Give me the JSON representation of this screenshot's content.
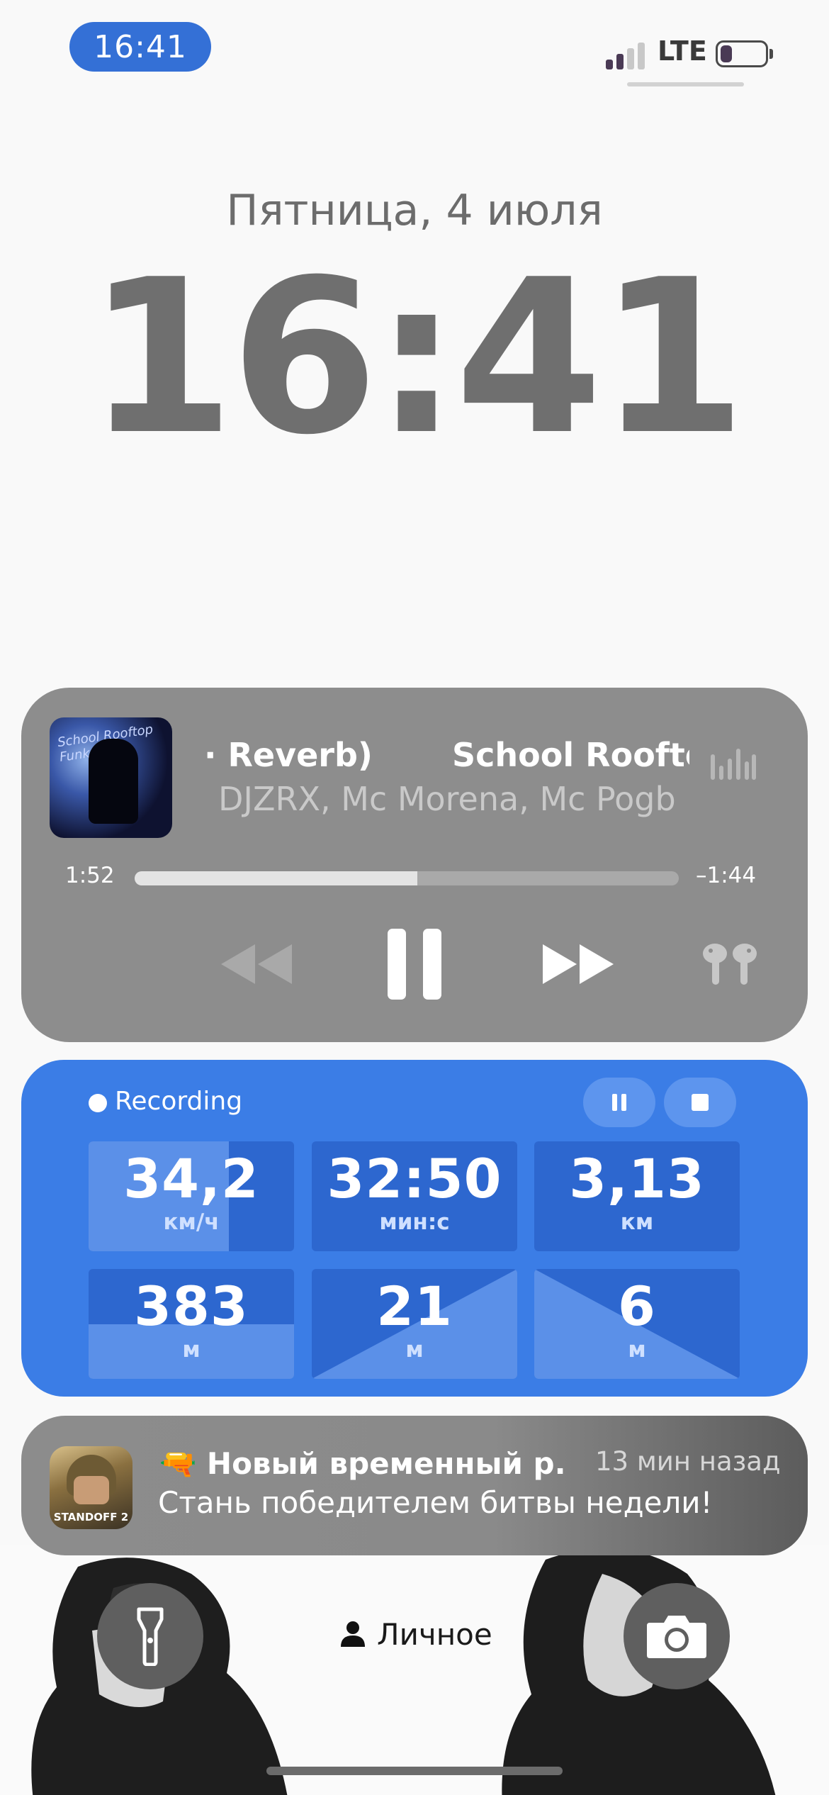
{
  "status_bar": {
    "time": "16:41",
    "network": "LTE",
    "signal_bars_active": 2,
    "signal_bars_total": 4,
    "battery_level": 0.35,
    "accent_color": "#3470d6"
  },
  "lock": {
    "date": "Пятница, 4 июля",
    "time": "16:41"
  },
  "now_playing": {
    "title_visible": "· Reverb)       School Rooftop Fu",
    "artist_visible": "DJZRX, Mc Morena, Mc Pogb",
    "artwork_text": "School Rooftop Funk",
    "elapsed": "1:52",
    "remaining": "–1:44",
    "progress": 0.52,
    "icons": {
      "rewind": "rewind-icon",
      "pause": "pause-icon",
      "forward": "fast-forward-icon",
      "output": "airpods-icon",
      "waveform": "waveform-icon"
    }
  },
  "recording": {
    "label": "Recording",
    "accent_color": "#3b7de6",
    "stats": [
      {
        "value": "34,2",
        "unit": "км/ч"
      },
      {
        "value": "32:50",
        "unit": "мин:с"
      },
      {
        "value": "3,13",
        "unit": "км"
      },
      {
        "value": "383",
        "unit": "м"
      },
      {
        "value": "21",
        "unit": "м"
      },
      {
        "value": "6",
        "unit": "м"
      }
    ]
  },
  "notification": {
    "app_name": "STANDOFF 2",
    "emoji": "🔫",
    "title": "Новый временный р...",
    "time": "13 мин назад",
    "body": "Стань победителем битвы недели!"
  },
  "bottom": {
    "focus_label": "Личное",
    "flashlight_icon": "flashlight-icon",
    "camera_icon": "camera-icon"
  }
}
